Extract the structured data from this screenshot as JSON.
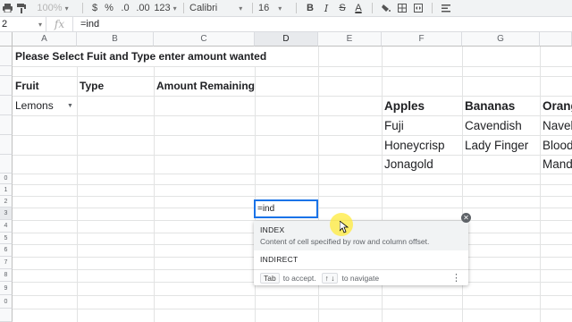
{
  "toolbar": {
    "zoom": "100%",
    "currency": "$",
    "percent": "%",
    "dec_decrease": ".0",
    "dec_increase": ".00",
    "number_format": "123",
    "font": "Calibri",
    "font_size": "16",
    "bold": "B",
    "italic": "I",
    "strike": "S",
    "text_color": "A"
  },
  "formula_bar": {
    "name_box": "2",
    "fx": "fx",
    "formula": "=ind"
  },
  "columns": [
    "A",
    "B",
    "C",
    "D",
    "E",
    "F",
    "G"
  ],
  "rows": [
    "",
    "",
    "",
    "",
    "",
    "",
    "",
    "",
    "",
    "0",
    "1",
    "2",
    "3",
    "4",
    "5",
    "6",
    "7",
    "8",
    "9",
    "0"
  ],
  "cells": {
    "title": "Please Select Fuit and Type enter amount wanted",
    "fruit_header": "Fruit",
    "type_header": "Type",
    "amount_header": "Amount Remaining",
    "fruit_value": "Lemons",
    "apples_header": "Apples",
    "bananas_header": "Bananas",
    "oranges_header": "Orang",
    "apple_1": "Fuji",
    "apple_2": "Honeycrisp",
    "apple_3": "Jonagold",
    "banana_1": "Cavendish",
    "banana_2": "Lady Finger",
    "orange_1": "Navel",
    "orange_2": "Blood",
    "orange_3": "Mand"
  },
  "editor": {
    "value": "=ind"
  },
  "autocomplete": {
    "item_1_name": "INDEX",
    "item_1_desc": "Content of cell specified by row and column offset.",
    "item_2_name": "INDIRECT",
    "footer_tab": "Tab",
    "footer_accept": "to accept.",
    "footer_arrows": "↑ ↓",
    "footer_navigate": "to navigate"
  },
  "colors": {
    "selection_blue": "#1a73e8",
    "header_bg": "#f8f9fa",
    "cursor_highlight": "#ffeb3b"
  }
}
